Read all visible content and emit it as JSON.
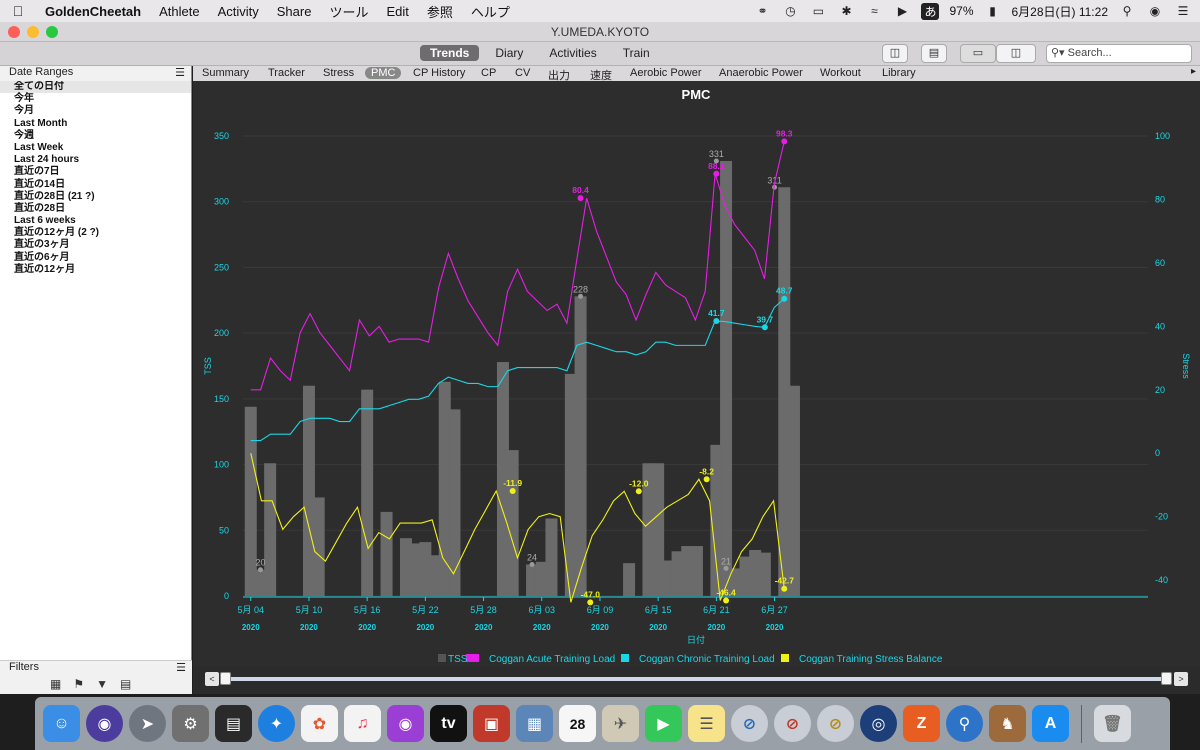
{
  "menubar": {
    "app": "GoldenCheetah",
    "items": [
      "Athlete",
      "Activity",
      "Share",
      "ツール",
      "Edit",
      "参照",
      "ヘルプ"
    ],
    "battery": "97%",
    "ime": "あ",
    "datetime": "6月28日(日)  11:22"
  },
  "window": {
    "title": "Y.UMEDA.KYOTO"
  },
  "toolbar": {
    "views": [
      "Trends",
      "Diary",
      "Activities",
      "Train"
    ],
    "active_view": "Trends",
    "search_placeholder": "Search..."
  },
  "sidebar": {
    "header": "Date Ranges",
    "ranges": [
      "全ての日付",
      "今年",
      "今月",
      "Last Month",
      "今週",
      "Last Week",
      "Last 24 hours",
      "直近の7日",
      "直近の14日",
      "直近の28日 (21 ?)",
      "直近の28日",
      "Last 6 weeks",
      "直近の12ヶ月 (2 ?)",
      "直近の3ヶ月",
      "直近の6ヶ月",
      "直近の12ヶ月"
    ],
    "filters_label": "Filters"
  },
  "tabs": [
    "Summary",
    "Tracker",
    "Stress",
    "PMC",
    "CP History",
    "CP",
    "CV",
    "出力",
    "速度",
    "Aerobic Power",
    "Anaerobic Power",
    "Workout",
    "Library"
  ],
  "active_tab": "PMC",
  "colors": {
    "tss": "#6b6b6b",
    "atl": "#e61ee6",
    "ctl": "#19d7e6",
    "tsb": "#f0f019",
    "axis": "#19d7e6",
    "background": "#2d2d2d"
  },
  "chart_data": {
    "type": "bar+line",
    "title": "PMC",
    "xlabel": "日付",
    "ylabel_left": "TSS",
    "ylabel_right": "Stress",
    "ylim_left": [
      0,
      350
    ],
    "ylim_right": [
      -45,
      100
    ],
    "x_ticks": [
      "5月 04",
      "5月 10",
      "5月 16",
      "5月 22",
      "5月 28",
      "6月 03",
      "6月 09",
      "6月 15",
      "6月 21",
      "6月 27"
    ],
    "x_tick_year": "2020",
    "y_ticks_left": [
      0,
      50,
      100,
      150,
      200,
      250,
      300,
      350
    ],
    "y_ticks_right": [
      -40,
      -20,
      0,
      20,
      40,
      60,
      80,
      100
    ],
    "legend": [
      "TSS",
      "Coggan Acute Training Load",
      "Coggan Chronic Training Load",
      "Coggan Training Stress Balance"
    ],
    "legend_position": "bottom",
    "dates": [
      "05-04",
      "05-05",
      "05-06",
      "05-07",
      "05-08",
      "05-09",
      "05-10",
      "05-11",
      "05-12",
      "05-13",
      "05-14",
      "05-15",
      "05-16",
      "05-17",
      "05-18",
      "05-19",
      "05-20",
      "05-21",
      "05-22",
      "05-23",
      "05-24",
      "05-25",
      "05-26",
      "05-27",
      "05-28",
      "05-29",
      "05-30",
      "05-31",
      "06-01",
      "06-02",
      "06-03",
      "06-04",
      "06-05",
      "06-06",
      "06-07",
      "06-08",
      "06-09",
      "06-10",
      "06-11",
      "06-12",
      "06-13",
      "06-14",
      "06-15",
      "06-16",
      "06-17",
      "06-18",
      "06-19",
      "06-20",
      "06-21",
      "06-22",
      "06-23",
      "06-24",
      "06-25",
      "06-26",
      "06-27",
      "06-28"
    ],
    "series": [
      {
        "name": "TSS",
        "values": [
          144,
          20,
          101,
          0,
          0,
          0,
          160,
          75,
          0,
          0,
          0,
          0,
          157,
          0,
          64,
          0,
          44,
          40,
          41,
          31,
          163,
          142,
          0,
          0,
          0,
          0,
          178,
          111,
          0,
          24,
          26,
          59,
          0,
          169,
          228,
          0,
          0,
          0,
          0,
          25,
          0,
          101,
          101,
          27,
          34,
          38,
          38,
          0,
          115,
          331,
          21,
          30,
          35,
          33,
          0,
          311,
          160
        ],
        "labels": {
          "05-05": 20,
          "06-02": 24,
          "06-07": 228,
          "06-21": 331,
          "06-22": 21,
          "06-27": 311
        }
      },
      {
        "name": "Coggan Acute Training Load",
        "values": [
          20,
          20,
          30,
          26,
          23,
          38,
          44,
          38,
          34,
          30,
          26,
          42,
          37,
          40,
          35,
          36,
          36,
          36,
          35,
          52,
          63,
          55,
          48,
          43,
          38,
          34,
          51,
          58,
          51,
          48,
          45,
          47,
          41,
          61,
          80.4,
          70,
          62,
          54,
          50,
          42,
          50,
          57,
          53,
          51,
          49,
          42,
          51,
          88.1,
          78,
          72,
          68,
          64,
          55,
          85,
          98.3
        ],
        "labels": {
          "06-07": 80.4,
          "06-21": 88.1,
          "06-28": 98.3
        }
      },
      {
        "name": "Coggan Chronic Training Load",
        "values": [
          4,
          4,
          6,
          6,
          6,
          10,
          11,
          11,
          11,
          10,
          10,
          14,
          14,
          14,
          15,
          16,
          17,
          17,
          18,
          22,
          24,
          23,
          22,
          22,
          21,
          21,
          26,
          27,
          27,
          27,
          27,
          27,
          26,
          34,
          35,
          34,
          33,
          32,
          32,
          31,
          32,
          35,
          35,
          34,
          34,
          34,
          34,
          41.7,
          41.5,
          41,
          40.5,
          40,
          39.7,
          46,
          48.7
        ],
        "labels": {
          "06-21": 41.7,
          "06-26": 39.7,
          "06-28": 48.7
        }
      },
      {
        "name": "Coggan Training Stress Balance",
        "values": [
          0,
          -15,
          -15,
          -24,
          -20,
          -17,
          -31,
          -34,
          -28,
          -22,
          -17,
          -30,
          -25,
          -27,
          -22,
          -22,
          -22,
          -21,
          -33,
          -38,
          -31,
          -24,
          -18,
          -11.9,
          -22,
          -33,
          -24,
          -20,
          -19,
          -20,
          -47.0,
          -36,
          -26,
          -21,
          -15,
          -12.0,
          -19,
          -23,
          -20,
          -17,
          -15,
          -13,
          -8.2,
          -15,
          -46.4,
          -38,
          -31,
          -27,
          -20,
          -15,
          -42.7
        ],
        "labels": {
          "05-31": -11.9,
          "06-08": -47.0,
          "06-13": -12.0,
          "06-20": -8.2,
          "06-22": -46.4,
          "06-28": -42.7
        }
      }
    ]
  }
}
